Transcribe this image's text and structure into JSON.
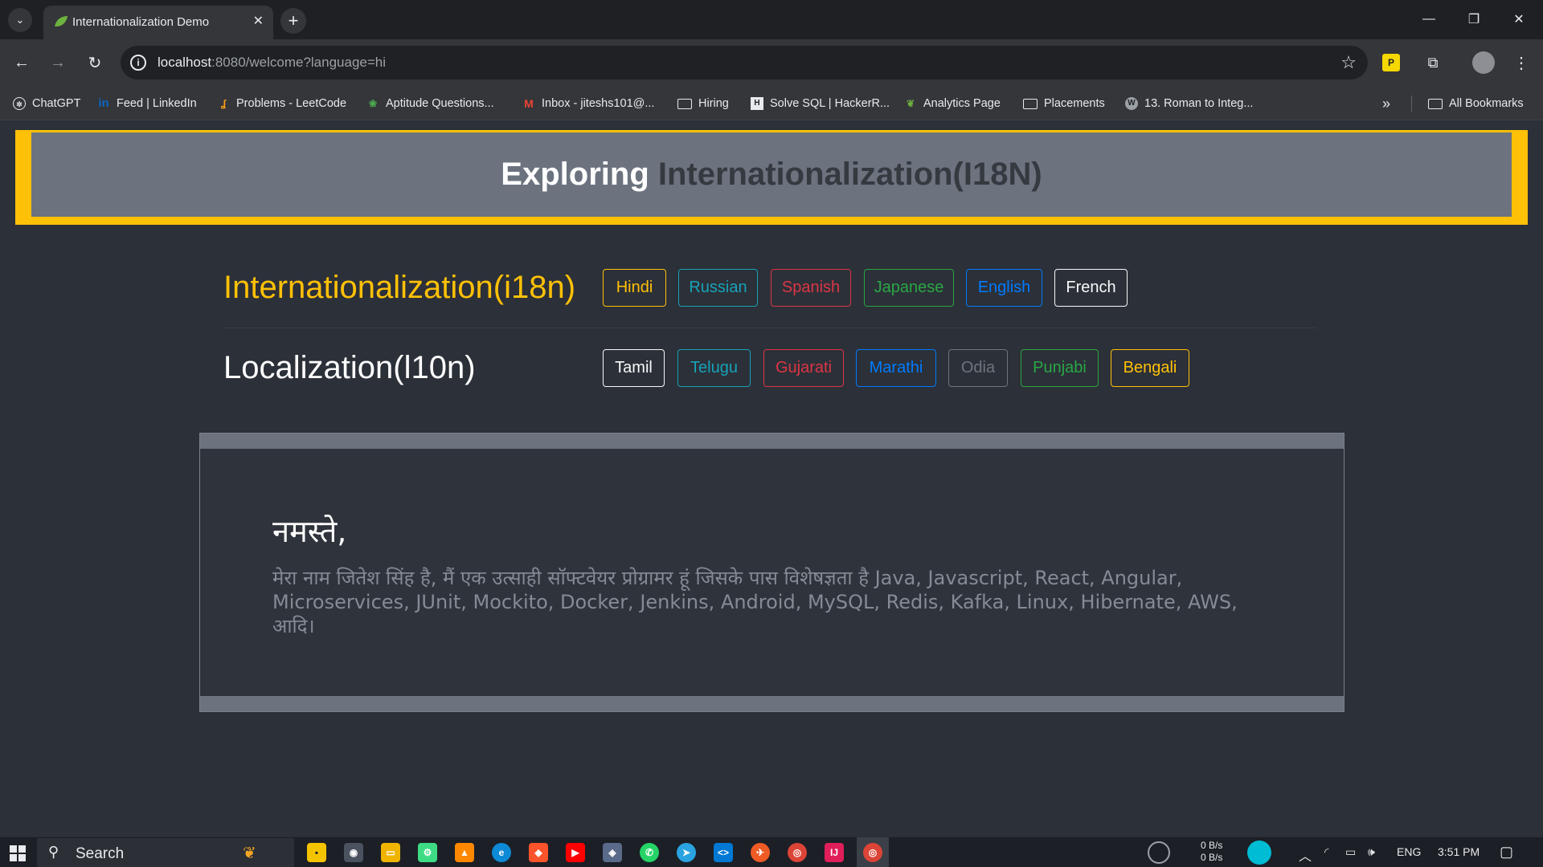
{
  "browser": {
    "tab_title": "Internationalization Demo",
    "url_host": "localhost",
    "url_rest": ":8080/welcome?language=hi",
    "bookmarks": [
      {
        "label": "ChatGPT",
        "icon": "chatgpt-icon"
      },
      {
        "label": "Feed | LinkedIn",
        "icon": "linkedin-icon"
      },
      {
        "label": "Problems - LeetCode",
        "icon": "leetcode-icon"
      },
      {
        "label": "Aptitude Questions...",
        "icon": "aptitude-icon"
      },
      {
        "label": "Inbox - jiteshs101@...",
        "icon": "gmail-icon"
      },
      {
        "label": "Hiring",
        "icon": "folder-icon"
      },
      {
        "label": "Solve SQL | HackerR...",
        "icon": "hackerrank-icon"
      },
      {
        "label": "Analytics Page",
        "icon": "leaf-icon"
      },
      {
        "label": "Placements",
        "icon": "folder-icon"
      },
      {
        "label": "13. Roman to Integ...",
        "icon": "w-icon"
      }
    ],
    "more_bookmarks": "»",
    "all_bookmarks": "All Bookmarks"
  },
  "page": {
    "hero_word1": "Exploring",
    "hero_word2": "Internationalization(I18N)",
    "i18n_label": "Internationalization(i18n)",
    "l10n_label": "Localization(l10n)",
    "i18n_buttons": [
      "Hindi",
      "Russian",
      "Spanish",
      "Japanese",
      "English",
      "French"
    ],
    "l10n_buttons": [
      "Tamil",
      "Telugu",
      "Gujarati",
      "Marathi",
      "Odia",
      "Punjabi",
      "Bengali"
    ],
    "greeting": "नमस्ते,",
    "bio": "मेरा नाम जितेश सिंह है, मैं एक उत्साही सॉफ्टवेयर प्रोग्रामर हूं जिसके पास विशेषज्ञता है Java, Javascript, React, Angular, Microservices, JUnit, Mockito, Docker, Jenkins, Android, MySQL, Redis, Kafka, Linux, Hibernate, AWS, आदि।"
  },
  "taskbar": {
    "search_placeholder": "Search",
    "net_up": "0 B/s",
    "net_down": "0 B/s",
    "language": "ENG",
    "time": "3:51 PM"
  },
  "colors": {
    "accent_yellow": "#ffc107",
    "hero_bg": "#6c737f",
    "page_bg": "#2c3038"
  }
}
